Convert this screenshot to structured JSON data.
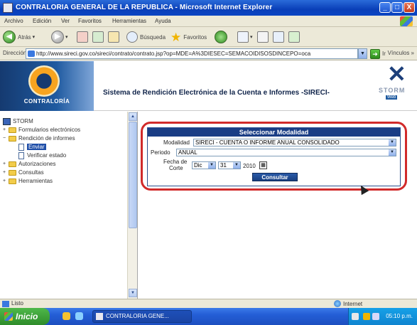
{
  "window": {
    "title": "CONTRALORIA GENERAL DE LA REPUBLICA - Microsoft Internet Explorer",
    "minimize": "_",
    "maximize": "□",
    "close": "X"
  },
  "menu": {
    "items": [
      "Archivo",
      "Edición",
      "Ver",
      "Favoritos",
      "Herramientas",
      "Ayuda"
    ]
  },
  "toolbar": {
    "back_label": "Atrás",
    "search_label": "Búsqueda",
    "favorites_label": "Favoritos"
  },
  "address": {
    "label": "Dirección",
    "url": "http://www.sireci.gov.co/sireci/contrato/contrato.jsp?op=MDE=A%3DIESEC=SEMACOIDISOSDINCEPO=oca",
    "go_label": "Ir",
    "links_label": "Vínculos »"
  },
  "banner": {
    "logo_text": "CONTRALORÍA",
    "title": "Sistema de Rendición Electrónica de la Cuenta e Informes -SIRECI-",
    "storm_text": "STORM",
    "storm_sub": "Web"
  },
  "tree": {
    "root": "STORM",
    "items": [
      {
        "label": "Formularios electrónicos",
        "expander": "+"
      },
      {
        "label": "Rendición de informes",
        "expander": "−"
      },
      {
        "label": "Enviar",
        "expander": ""
      },
      {
        "label": "Verificar estado",
        "expander": ""
      },
      {
        "label": "Autorizaciones",
        "expander": "+"
      },
      {
        "label": "Consultas",
        "expander": "+"
      },
      {
        "label": "Herramientas",
        "expander": "+"
      }
    ]
  },
  "form": {
    "header": "Seleccionar Modalidad",
    "modalidad_label": "Modalidad",
    "modalidad_value": "SIRECI - CUENTA O INFORME ANUAL CONSOLIDADO",
    "periodo_label": "Periodo",
    "periodo_value": "ANUAL",
    "fecha_label_1": "Fecha de",
    "fecha_label_2": "Corte",
    "day_value": "Dic",
    "month_value": "31",
    "year_value": "2010",
    "submit_label": "Consultar"
  },
  "status": {
    "text": "Listo",
    "zone": "Internet"
  },
  "taskbar": {
    "start_label": "Inicio",
    "task_label": "CONTRALORIA GENE...",
    "clock": "05:10 p.m."
  }
}
